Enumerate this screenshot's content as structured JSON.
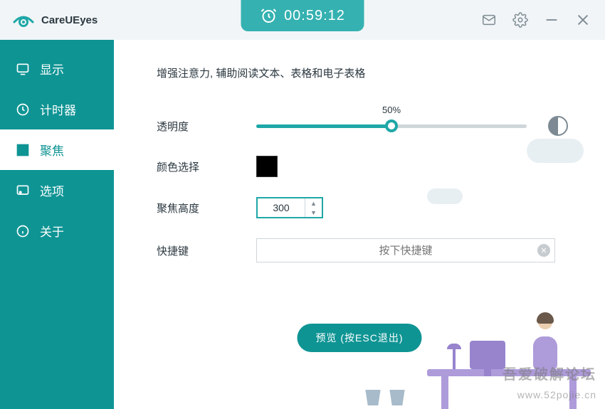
{
  "brand": "CareUEyes",
  "timer": "00:59:12",
  "sidebar": {
    "items": [
      {
        "label": "显示"
      },
      {
        "label": "计时器"
      },
      {
        "label": "聚焦"
      },
      {
        "label": "选项"
      },
      {
        "label": "关于"
      }
    ],
    "active_index": 2
  },
  "main": {
    "description": "增强注意力, 辅助阅读文本、表格和电子表格",
    "opacity_label": "透明度",
    "opacity_value": "50%",
    "opacity_percent": 50,
    "color_label": "颜色选择",
    "color_value": "#000000",
    "height_label": "聚焦高度",
    "height_value": "300",
    "hotkey_label": "快捷键",
    "hotkey_placeholder": "按下快捷键",
    "hotkey_value": "",
    "preview_button": "预览 (按ESC退出)"
  },
  "watermark": {
    "line1": "吾爱破解论坛",
    "line2": "www.52pojie.cn"
  },
  "icons": {
    "timer": "alarm-clock",
    "mail": "envelope",
    "settings": "gear",
    "minimize": "dash",
    "close": "x"
  },
  "colors": {
    "accent": "#0f9494",
    "accent_light": "#35b1b1"
  }
}
